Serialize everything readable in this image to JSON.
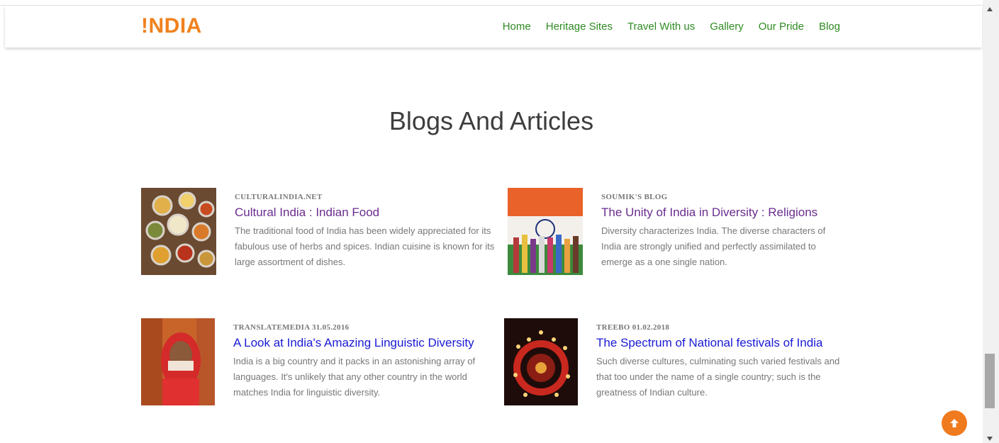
{
  "brand": {
    "logo": "!NDIA",
    "logo_color": "#f0821e"
  },
  "nav": {
    "items": [
      {
        "label": "Home"
      },
      {
        "label": "Heritage Sites"
      },
      {
        "label": "Travel With us"
      },
      {
        "label": "Gallery"
      },
      {
        "label": "Our Pride"
      },
      {
        "label": "Blog"
      }
    ],
    "color": "#2e8b22"
  },
  "section": {
    "title": "Blogs And Articles"
  },
  "articles": [
    {
      "source": "CULTURALINDIA.NET",
      "title": "Cultural India : Indian Food",
      "description": "The traditional food of India has been widely appreciated for its fabulous use of herbs and spices. Indian cuisine is known for its large assortment of dishes."
    },
    {
      "source": "SOUMIK'S BLOG",
      "title": "The Unity of India in Diversity : Religions",
      "description": "Diversity characterizes India. The diverse characters of India are strongly unified and perfectly assimilated to emerge as a one single nation."
    },
    {
      "source": "TRANSLATEMEDIA  31.05.2016",
      "title": "A Look at India's Amazing Linguistic Diversity",
      "description": "India is a big country and it packs in an astonishing array of languages. It's unlikely that any other country in the world matches India for linguistic diversity."
    },
    {
      "source": "TREEBO  01.02.2018",
      "title": "The Spectrum of National festivals of India",
      "description": "Such diverse cultures, culminating such varied festivals and that too under the name of a single country; such is the greatness of Indian culture."
    }
  ],
  "colors": {
    "visited_link": "#6a2d8f",
    "link": "#1a1ad4",
    "accent": "#f07a1e"
  },
  "icons": {
    "scroll_to_top": "arrow-up-icon"
  }
}
